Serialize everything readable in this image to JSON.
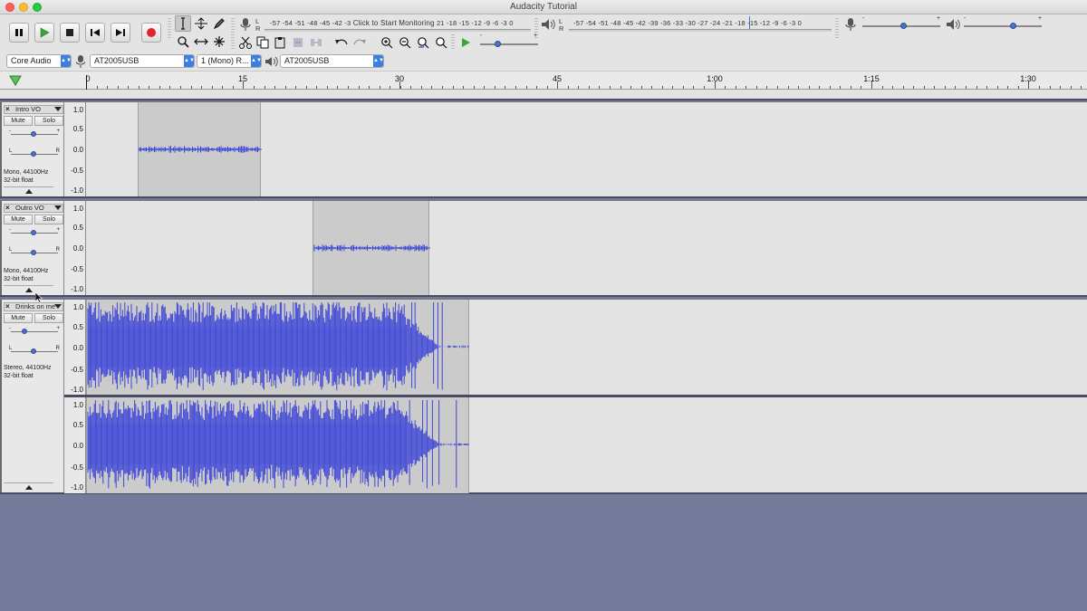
{
  "window": {
    "title": "Audacity Tutorial"
  },
  "meters": {
    "record_scale": "-57 -54 -51 -48 -45 -42 -3",
    "record_prompt": "Click to Start Monitoring",
    "record_scale_tail": "21 -18 -15 -12 -9 -6 -3 0",
    "play_scale": "-57 -54 -51 -48 -45 -42 -39 -36 -33 -30 -27 -24 -21 -18 -15 -12 -9 -6 -3 0",
    "lr_top": "L",
    "lr_bottom": "R"
  },
  "devices": {
    "host": "Core Audio",
    "recording_device": "AT2005USB",
    "channels": "1 (Mono) R...",
    "playback_device": "AT2005USB"
  },
  "ruler": {
    "labels": [
      "0",
      "15",
      "30",
      "45",
      "1:00",
      "1:15",
      "1:30"
    ]
  },
  "scale_values": [
    "1.0",
    "0.5",
    "0.0",
    "-0.5",
    "-1.0"
  ],
  "tracks": [
    {
      "name": "Intro VO",
      "mute": "Mute",
      "solo": "Solo",
      "info_line1": "Mono, 44100Hz",
      "info_line2": "32-bit float"
    },
    {
      "name": "Outro VO",
      "mute": "Mute",
      "solo": "Solo",
      "info_line1": "Mono, 44100Hz",
      "info_line2": "32-bit float"
    },
    {
      "name": "Drinks on me",
      "mute": "Mute",
      "solo": "Solo",
      "info_line1": "Stereo, 44100Hz",
      "info_line2": "32-bit float"
    }
  ],
  "slider_labels": {
    "minus": "-",
    "plus": "+",
    "left": "L",
    "right": "R"
  },
  "colors": {
    "waveform": "#3f47d6",
    "record": "#e0262b",
    "play": "#3aa53a"
  }
}
